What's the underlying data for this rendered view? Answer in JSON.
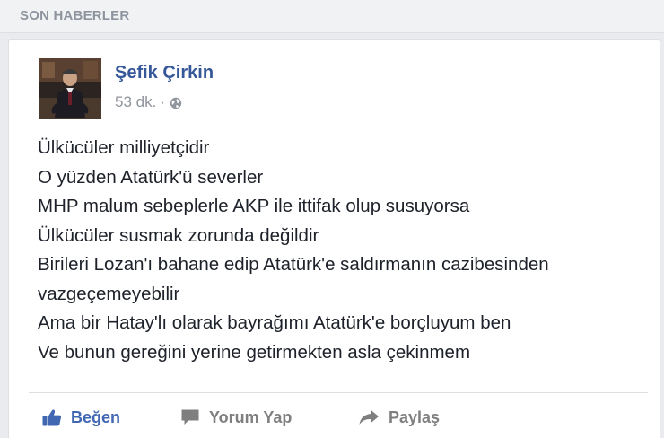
{
  "section": {
    "title": "SON HABERLER"
  },
  "post": {
    "author": "Şefik Çirkin",
    "time": "53 dk.",
    "separator": "·",
    "privacy_icon": "globe-icon",
    "lines": [
      "Ülkücüler milliyetçidir",
      "O yüzden Atatürk'ü severler",
      "MHP malum sebeplerle AKP ile ittifak olup susuyorsa",
      "Ülkücüler susmak zorunda değildir",
      "Birileri Lozan'ı bahane edip Atatürk'e saldırmanın cazibesinden",
      "vazgeçemeyebilir",
      "Ama bir Hatay'lı olarak bayrağımı Atatürk'e borçluyum ben",
      "Ve bunun gereğini yerine getirmekten asla çekinmem"
    ]
  },
  "actions": {
    "like": "Beğen",
    "comment": "Yorum Yap",
    "share": "Paylaş"
  },
  "colors": {
    "link_blue": "#365899",
    "like_blue": "#4267b2",
    "muted_gray": "#90949c",
    "text_dark": "#1d2129"
  }
}
